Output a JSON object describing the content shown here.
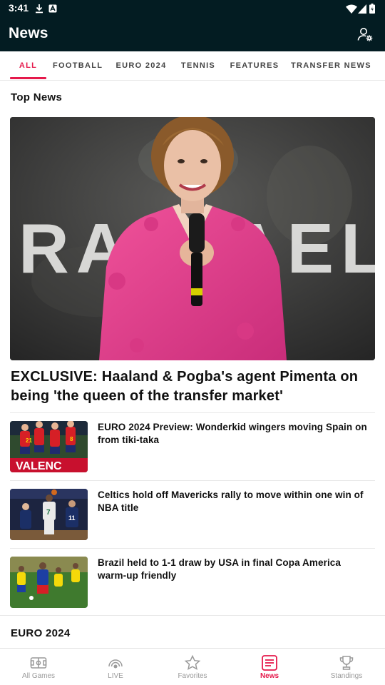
{
  "status_bar": {
    "time": "3:41"
  },
  "app_bar": {
    "title": "News"
  },
  "tabs": [
    {
      "label": "ALL",
      "active": true
    },
    {
      "label": "FOOTBALL"
    },
    {
      "label": "EURO 2024"
    },
    {
      "label": "TENNIS"
    },
    {
      "label": "FEATURES"
    },
    {
      "label": "TRANSFER NEWS"
    }
  ],
  "top_news": {
    "section_title": "Top News",
    "hero": {
      "background_text": "RAFFAELA",
      "headline": "EXCLUSIVE: Haaland & Pogba's agent Pimenta on being 'the queen of the transfer market'"
    },
    "articles": [
      {
        "title": "EURO 2024 Preview: Wonderkid wingers moving Spain on from tiki-taka"
      },
      {
        "title": "Celtics hold off Mavericks rally to move within one win of NBA title"
      },
      {
        "title": "Brazil held to 1-1 draw by USA in final Copa America warm-up friendly"
      }
    ]
  },
  "next_section": {
    "title": "EURO 2024"
  },
  "bottom_nav": [
    {
      "label": "All Games",
      "icon": "pitch-icon"
    },
    {
      "label": "LIVE",
      "icon": "live-broadcast-icon"
    },
    {
      "label": "Favorites",
      "icon": "star-icon"
    },
    {
      "label": "News",
      "icon": "news-icon",
      "active": true
    },
    {
      "label": "Standings",
      "icon": "trophy-icon"
    }
  ],
  "colors": {
    "header_bg": "#031c22",
    "accent": "#e5194b",
    "inactive": "#9a9a9a"
  }
}
